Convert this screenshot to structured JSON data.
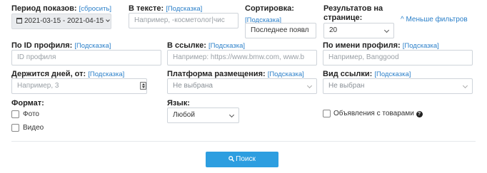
{
  "filters": {
    "period": {
      "label": "Период показов:",
      "reset": "[сбросить]",
      "value": "2021-03-15 - 2021-04-15"
    },
    "text": {
      "label": "В тексте:",
      "hint": "[Подсказка]",
      "placeholder": "Например, -косметолог|чис"
    },
    "sort": {
      "label": "Сортировка:",
      "hint": "[Подсказка]",
      "value": "Последнее появл"
    },
    "results": {
      "label_line1": "Результатов на",
      "label_line2": "странице:",
      "value": "20"
    },
    "less_filters": "^ Меньше фильтров",
    "profile_id": {
      "label": "По ID профиля:",
      "hint": "[Подсказка]",
      "placeholder": "ID профиля"
    },
    "link": {
      "label": "В ссылке:",
      "hint": "[Подсказка]",
      "placeholder": "Например: https://www.bmw.com, www.b"
    },
    "profile_name": {
      "label": "По имени профиля:",
      "hint": "[Подсказка]",
      "placeholder": "Например, Banggood"
    },
    "days": {
      "label": "Держится дней, от:",
      "hint": "[Подсказка]",
      "placeholder": "Например, 3"
    },
    "platform": {
      "label": "Платформа размещения:",
      "hint": "[Подсказка]",
      "value": "Не выбрана"
    },
    "link_type": {
      "label": "Вид ссылки:",
      "hint": "[Подсказка]",
      "value": "Не выбран"
    },
    "format": {
      "label": "Формат:",
      "options": [
        "Фото",
        "Видео"
      ]
    },
    "language": {
      "label": "Язык:",
      "value": "Любой"
    },
    "product_ads": {
      "label": "Объявления с товарами",
      "help_icon": "question-circle-icon"
    }
  },
  "search_button": {
    "label": "Поиск",
    "icon": "search-icon"
  },
  "colors": {
    "accent": "#2d9ee0",
    "hint": "#2a7fc9"
  }
}
